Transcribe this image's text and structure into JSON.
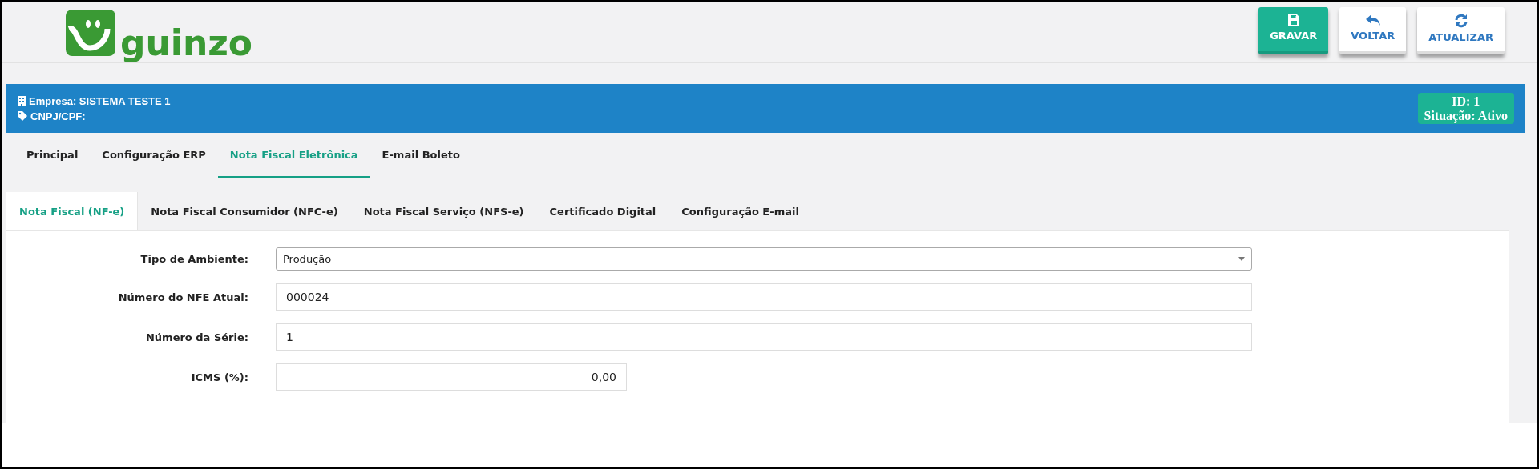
{
  "logo": {
    "text": "guinzo"
  },
  "toolbar": [
    {
      "label": "GRAVAR",
      "kind": "save"
    },
    {
      "label": "VOLTAR",
      "kind": "back"
    },
    {
      "label": "ATUALIZAR",
      "kind": "refresh"
    }
  ],
  "company": {
    "empresa": "Empresa: SISTEMA TESTE 1",
    "cnpj": "CNPJ/CPF:",
    "id": "ID: 1",
    "situacao": "Situação: Ativo"
  },
  "tabs": [
    {
      "label": "Principal",
      "selected": false
    },
    {
      "label": "Configuração ERP",
      "selected": false
    },
    {
      "label": "Nota Fiscal Eletrônica",
      "selected": true
    },
    {
      "label": "E-mail Boleto",
      "selected": false
    }
  ],
  "subtabs": [
    {
      "label": "Nota Fiscal (NF-e)",
      "selected": true
    },
    {
      "label": "Nota Fiscal Consumidor (NFC-e)",
      "selected": false
    },
    {
      "label": "Nota Fiscal Serviço (NFS-e)",
      "selected": false
    },
    {
      "label": "Certificado Digital",
      "selected": false
    },
    {
      "label": "Configuração E-mail",
      "selected": false
    }
  ],
  "form": [
    {
      "label": "Tipo de Ambiente:",
      "value": "Produção",
      "kind": "select"
    },
    {
      "label": "Número do NFE Atual:",
      "value": "000024",
      "kind": "text"
    },
    {
      "label": "Número da Série:",
      "value": "1",
      "kind": "text"
    },
    {
      "label": "ICMS (%):",
      "value": "0,00",
      "kind": "number"
    }
  ]
}
